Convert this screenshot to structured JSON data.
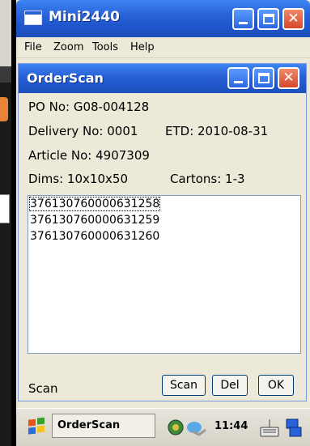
{
  "outer_window": {
    "title": "Mini2440",
    "menu": [
      "File",
      "Zoom",
      "Tools",
      "Help"
    ]
  },
  "inner_window": {
    "title": "OrderScan",
    "po_line": "PO No: G08-004128",
    "delivery_line": "Delivery No: 0001",
    "etd_line": "ETD: 2010-08-31",
    "article_line": "Article No: 4907309",
    "dims_line": "Dims: 10x10x50",
    "cartons_line": "Cartons: 1-3",
    "list_items": [
      "376130760000631258",
      "376130760000631259",
      "376130760000631260"
    ],
    "status_label": "Scan",
    "buttons": {
      "scan": "Scan",
      "del": "Del",
      "ok": "OK"
    }
  },
  "taskbar": {
    "task": "OrderScan",
    "clock": "11:44"
  },
  "colors": {
    "title_bar": "#2a62d8",
    "window_bg": "#ece9d8",
    "close_button": "#d8462b"
  }
}
